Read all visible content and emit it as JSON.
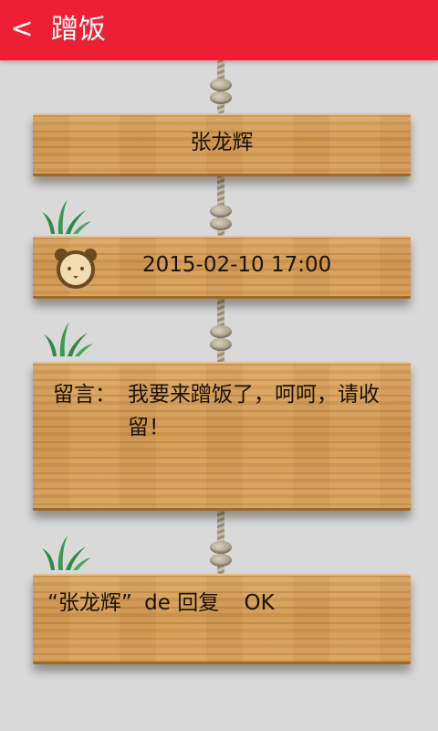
{
  "header": {
    "back_icon": "<",
    "title": "蹭饭"
  },
  "inviter": {
    "name": "张龙辉"
  },
  "time": {
    "value": "2015-02-10 17:00"
  },
  "message": {
    "label": "留言：",
    "text": "我要来蹭饭了，呵呵，请收留！"
  },
  "reply": {
    "quote_open": "“",
    "name": "张龙辉",
    "quote_close": "”",
    "suffix": "de 回复",
    "text": "OK"
  },
  "colors": {
    "header": "#ee1f35",
    "background": "#d9d9d9",
    "wood": "#d6a05c",
    "grass": "#2f8a45"
  }
}
